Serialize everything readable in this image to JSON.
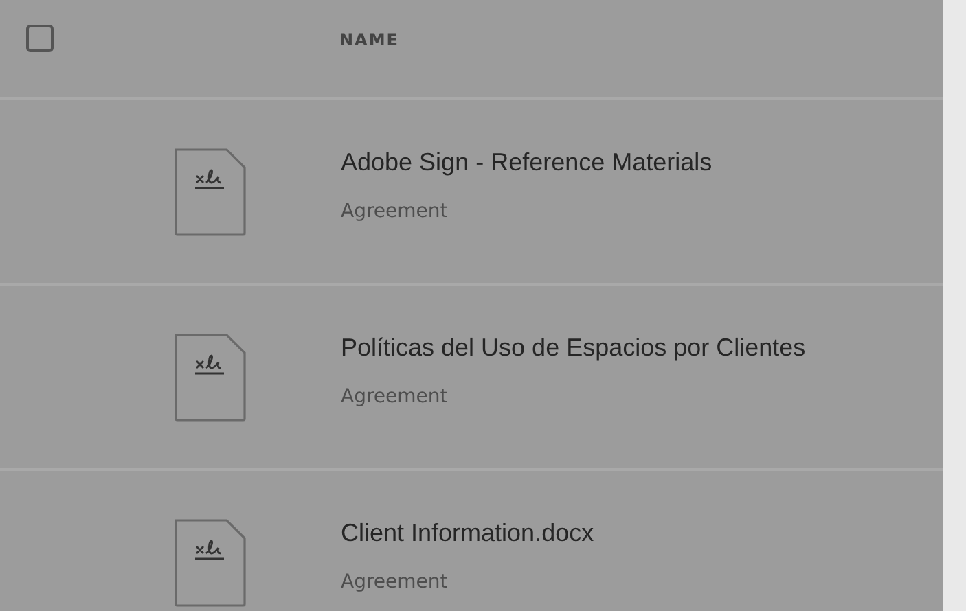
{
  "header": {
    "select_all": {
      "checked": false
    },
    "column": "NAME"
  },
  "rows": [
    {
      "name": "Adobe Sign - Reference Materials",
      "type": "Agreement"
    },
    {
      "name": "Políticas del Uso de Espacios por Clientes",
      "type": "Agreement"
    },
    {
      "name": "Client Information.docx",
      "type": "Agreement"
    }
  ]
}
